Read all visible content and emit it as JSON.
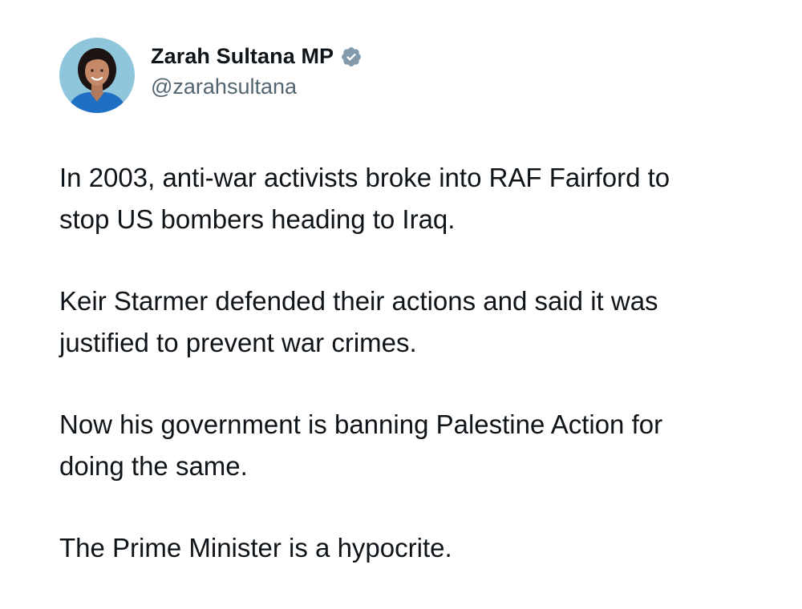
{
  "author": {
    "display_name": "Zarah Sultana MP",
    "handle": "@zarahsultana",
    "verified": true,
    "avatar_icon": "profile-photo",
    "badge_icon": "verified-badge-icon",
    "badge_color": "#829aab"
  },
  "tweet": {
    "paragraphs": [
      "In 2003, anti-war activists broke into RAF Fairford to\nstop US bombers heading to Iraq.",
      "Keir Starmer defended their actions and said it was\njustified to prevent war crimes.",
      "Now his government is banning Palestine Action for\ndoing the same.",
      "The Prime Minister is a hypocrite."
    ]
  },
  "colors": {
    "background": "#ffffff",
    "text": "#0f1419",
    "handle": "#536471"
  }
}
